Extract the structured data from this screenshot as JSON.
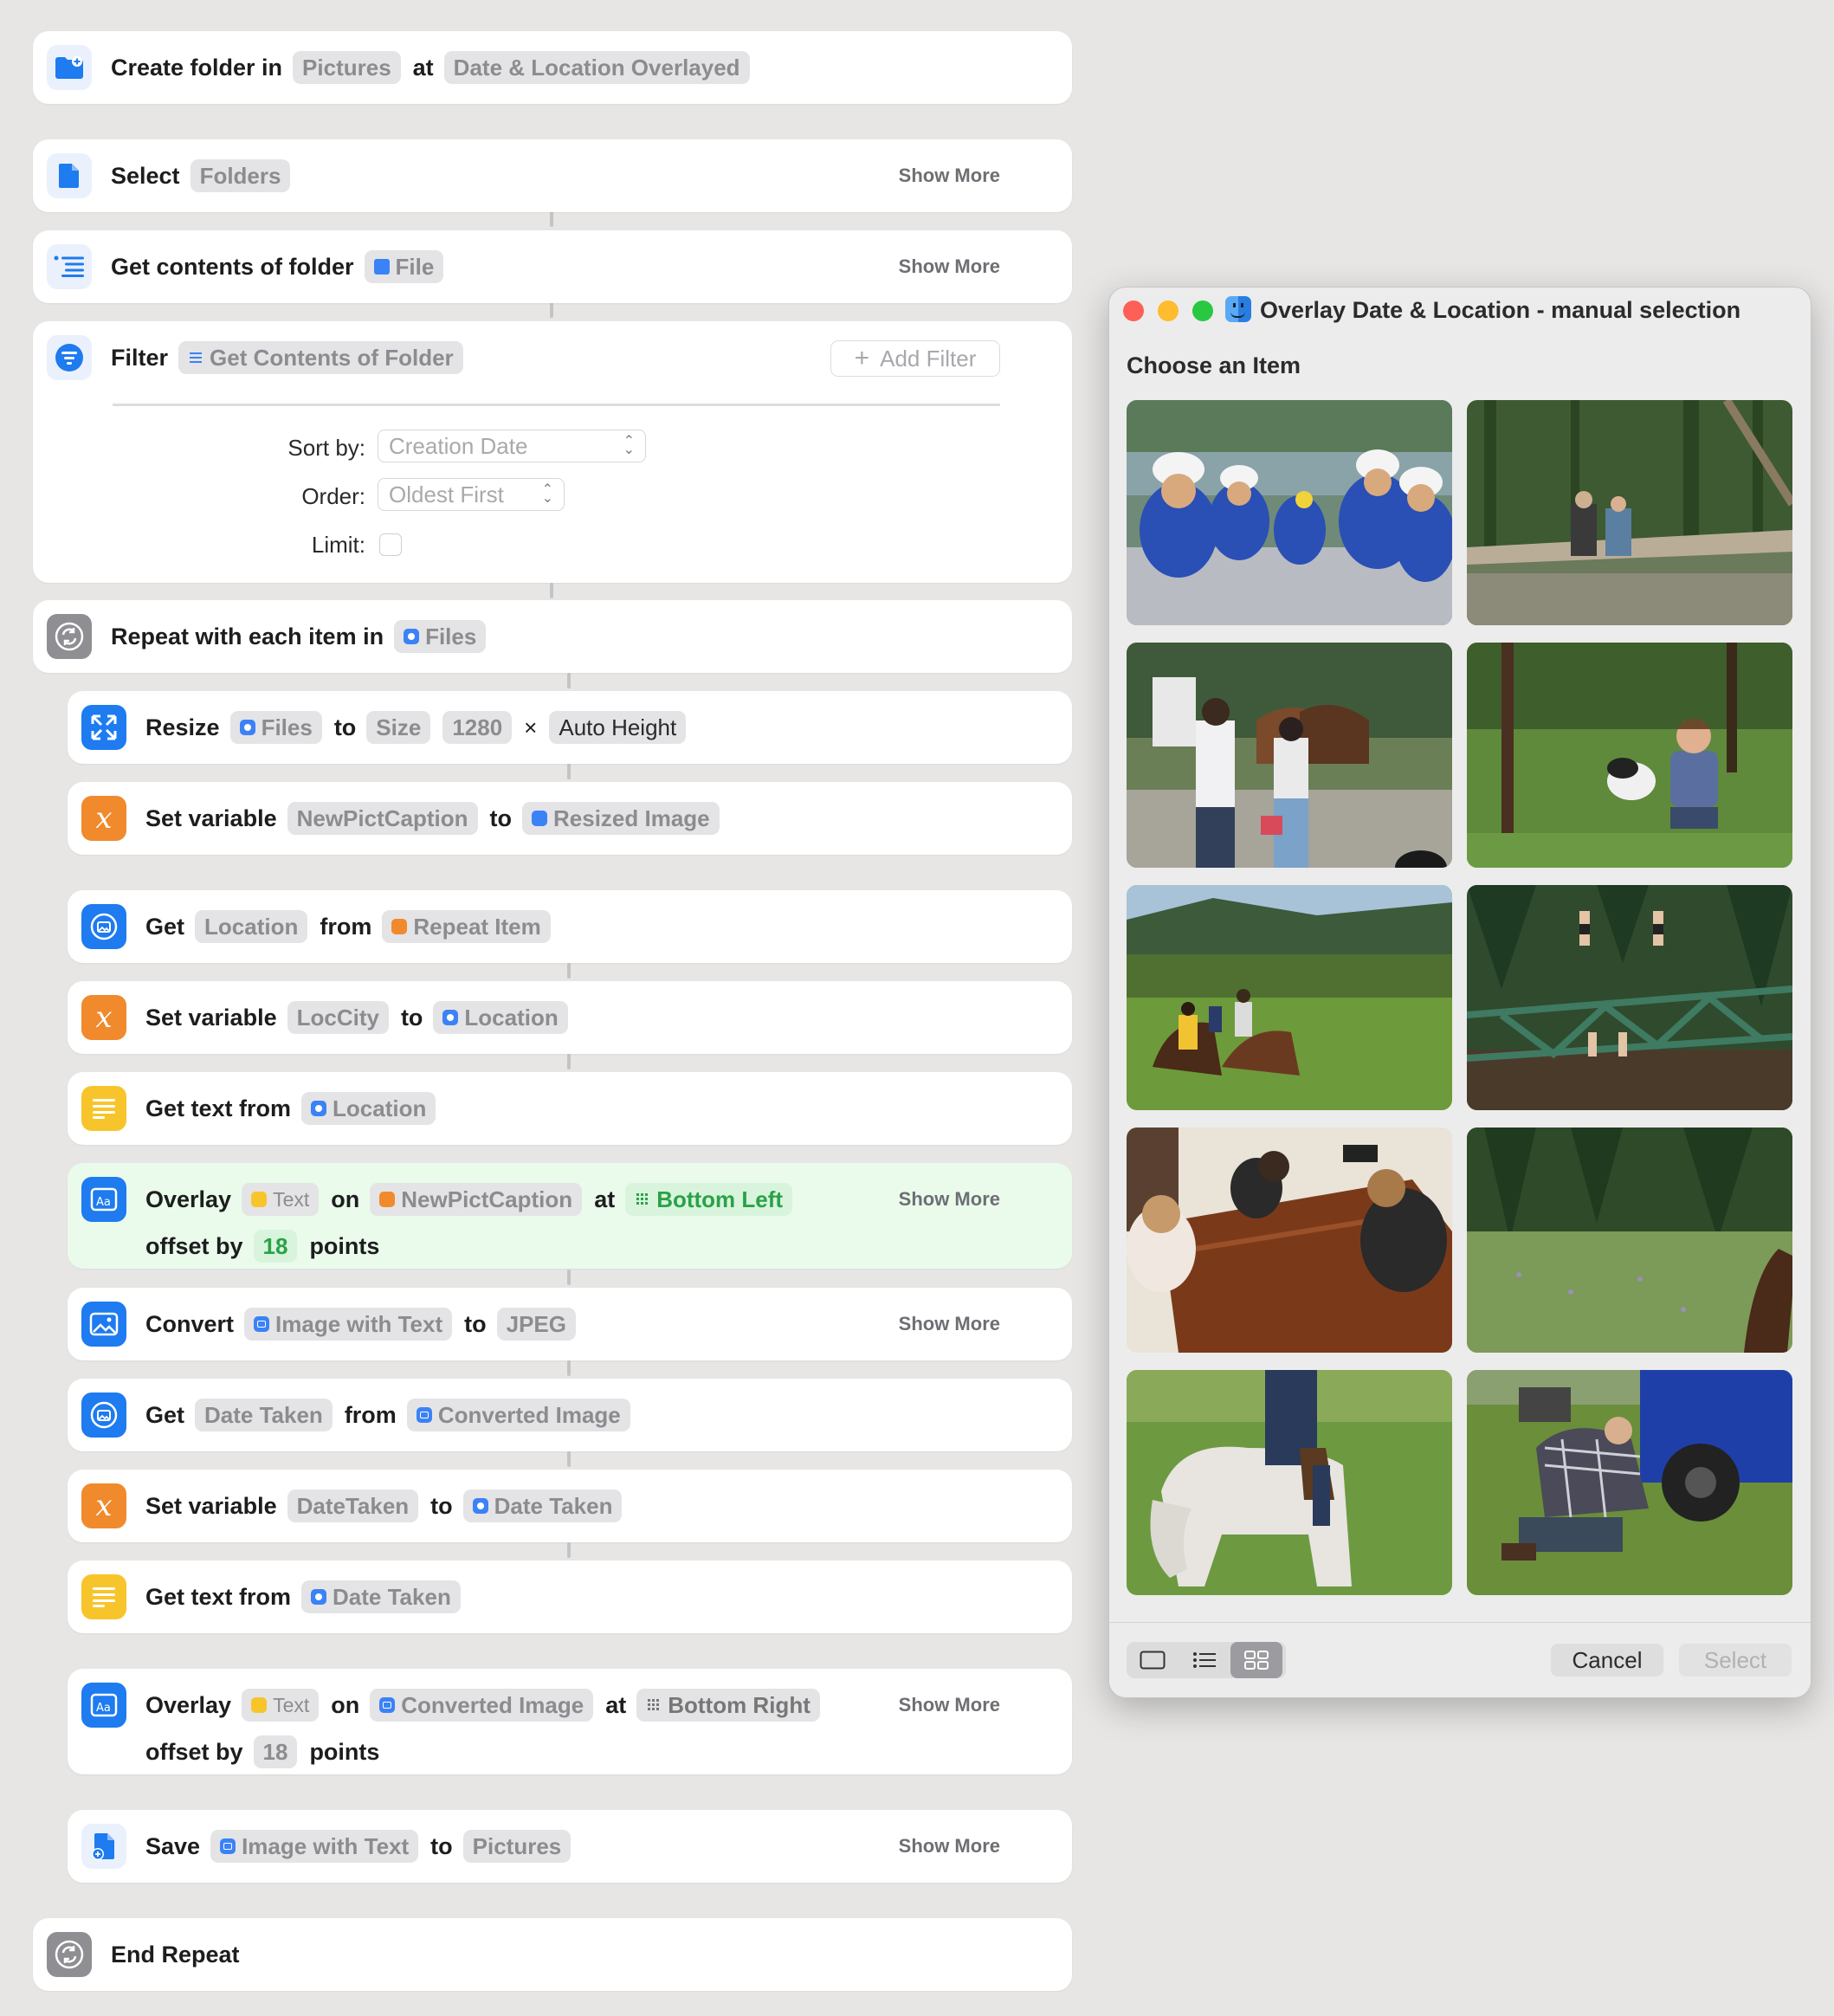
{
  "workflow": {
    "create_folder": {
      "w1": "Create folder in",
      "t1": "Pictures",
      "w2": "at",
      "t2": "Date & Location Overlayed"
    },
    "select": {
      "w1": "Select",
      "t1": "Folders",
      "more": "Show More"
    },
    "get_contents": {
      "w1": "Get contents of folder",
      "t1": "File",
      "more": "Show More"
    },
    "filter": {
      "w1": "Filter",
      "t1": "Get Contents of Folder",
      "add_filter": "Add Filter",
      "sort_label": "Sort by:",
      "sort_value": "Creation Date",
      "order_label": "Order:",
      "order_value": "Oldest First",
      "limit_label": "Limit:"
    },
    "repeat": {
      "w1": "Repeat with each item in",
      "t1": "Files"
    },
    "resize": {
      "w1": "Resize",
      "t1": "Files",
      "w2": "to",
      "t2": "Size",
      "t3": "1280",
      "x": "×",
      "t4": "Auto Height"
    },
    "setvar1": {
      "w1": "Set variable",
      "t1": "NewPictCaption",
      "w2": "to",
      "t2": "Resized Image"
    },
    "get_location": {
      "w1": "Get",
      "t1": "Location",
      "w2": "from",
      "t2": "Repeat Item"
    },
    "setvar2": {
      "w1": "Set variable",
      "t1": "LocCity",
      "w2": "to",
      "t2": "Location"
    },
    "gettext1": {
      "w1": "Get text from",
      "t1": "Location"
    },
    "overlay1": {
      "w1": "Overlay",
      "t1": "Text",
      "w2": "on",
      "t2": "NewPictCaption",
      "w3": "at",
      "t3": "Bottom Left",
      "w4": "offset by",
      "t4": "18",
      "w5": "points",
      "more": "Show More"
    },
    "convert": {
      "w1": "Convert",
      "t1": "Image with Text",
      "w2": "to",
      "t2": "JPEG",
      "more": "Show More"
    },
    "get_date": {
      "w1": "Get",
      "t1": "Date Taken",
      "w2": "from",
      "t2": "Converted Image"
    },
    "setvar3": {
      "w1": "Set variable",
      "t1": "DateTaken",
      "w2": "to",
      "t2": "Date Taken"
    },
    "gettext2": {
      "w1": "Get text from",
      "t1": "Date Taken"
    },
    "overlay2": {
      "w1": "Overlay",
      "t1": "Text",
      "w2": "on",
      "t2": "Converted Image",
      "w3": "at",
      "t3": "Bottom Right",
      "w4": "offset by",
      "t4": "18",
      "w5": "points",
      "more": "Show More"
    },
    "save": {
      "w1": "Save",
      "t1": "Image with Text",
      "w2": "to",
      "t2": "Pictures",
      "more": "Show More"
    },
    "end_repeat": {
      "w1": "End Repeat"
    }
  },
  "dialog": {
    "title": "Overlay Date & Location - manual selection",
    "heading": "Choose an Item",
    "cancel": "Cancel",
    "select": "Select",
    "view_mode_selected": "grid"
  },
  "colors": {
    "accent_blue": "#1e7bf0",
    "action_orange": "#f08a2c",
    "text_yellow": "#f7c52b",
    "highlight_green": "#eafbec",
    "close": "#fe5f57",
    "minimize": "#febc2e",
    "zoom": "#28c840"
  },
  "photos": [
    {
      "scene": "rafting-group-helmets"
    },
    {
      "scene": "forest-stream-fallen-log"
    },
    {
      "scene": "people-with-horses-ranch"
    },
    {
      "scene": "woman-with-dog-grass"
    },
    {
      "scene": "horseback-riders-meadow"
    },
    {
      "scene": "people-on-green-bridge"
    },
    {
      "scene": "kids-at-wooden-table"
    },
    {
      "scene": "meadow-with-horse"
    },
    {
      "scene": "rider-on-white-horse"
    },
    {
      "scene": "man-fixing-atv-wheel"
    }
  ]
}
